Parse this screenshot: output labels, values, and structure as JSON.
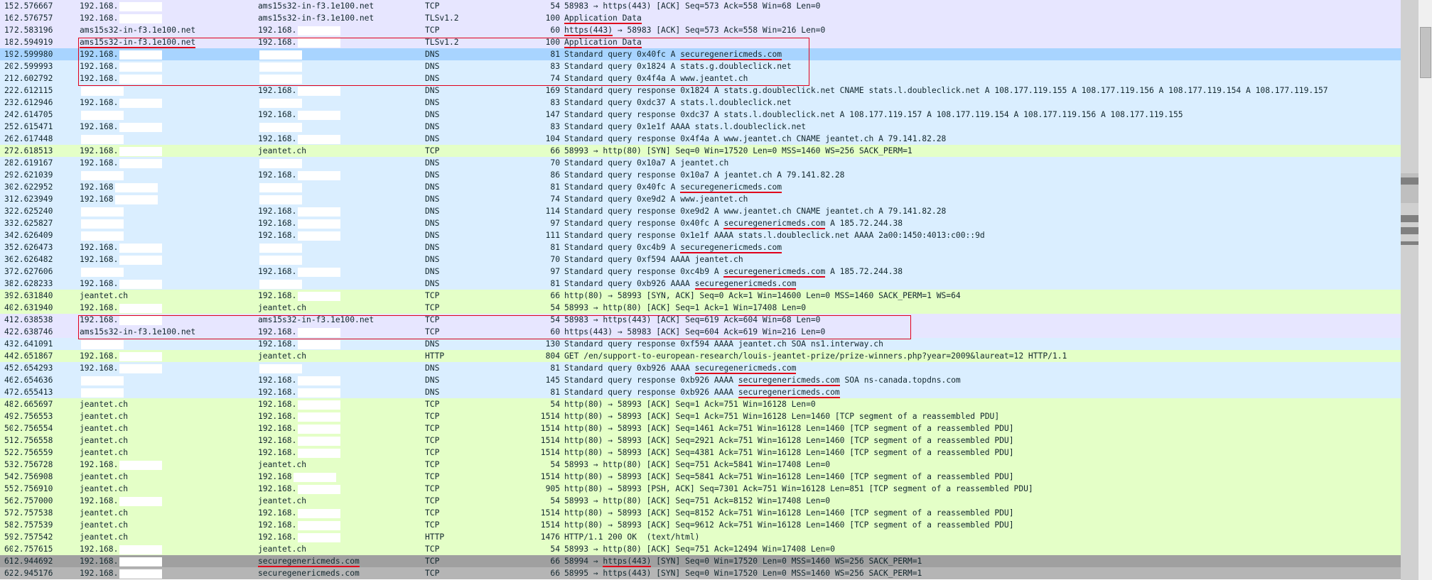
{
  "packets": [
    {
      "no": "15",
      "time": "2.576667",
      "src": "192.168.",
      "dst": "ams15s32-in-f3.1e100.net",
      "proto": "TCP",
      "len": "54",
      "info": "58983 → https(443) [ACK] Seq=573 Ack=558 Win=68 Len=0",
      "bg": "tcp"
    },
    {
      "no": "16",
      "time": "2.576757",
      "src": "192.168.",
      "dst": "ams15s32-in-f3.1e100.net",
      "proto": "TLSv1.2",
      "len": "100",
      "info": "Application Data",
      "bg": "tcp"
    },
    {
      "no": "17",
      "time": "2.583196",
      "src": "ams15s32-in-f3.1e100.net",
      "dst": "192.168.",
      "proto": "TCP",
      "len": "60",
      "info": "https(443) → 58983 [ACK] Seq=573 Ack=558 Win=216 Len=0",
      "bg": "tcp"
    },
    {
      "no": "18",
      "time": "2.594919",
      "src": "ams15s32-in-f3.1e100.net",
      "dst": "192.168.",
      "proto": "TLSv1.2",
      "len": "100",
      "info": "Application Data",
      "bg": "tcp"
    },
    {
      "no": "19",
      "time": "2.599980",
      "src": "192.168.",
      "dst": "",
      "proto": "DNS",
      "len": "81",
      "info": "Standard query 0x40fc A securegenericmeds.com",
      "bg": "sel"
    },
    {
      "no": "20",
      "time": "2.599993",
      "src": "192.168.",
      "dst": "",
      "proto": "DNS",
      "len": "83",
      "info": "Standard query 0x1824 A stats.g.doubleclick.net",
      "bg": "dns"
    },
    {
      "no": "21",
      "time": "2.602792",
      "src": "192.168.",
      "dst": "",
      "proto": "DNS",
      "len": "74",
      "info": "Standard query 0x4f4a A www.jeantet.ch",
      "bg": "dns"
    },
    {
      "no": "22",
      "time": "2.612115",
      "src": "",
      "dst": "192.168.",
      "proto": "DNS",
      "len": "169",
      "info": "Standard query response 0x1824 A stats.g.doubleclick.net CNAME stats.l.doubleclick.net A 108.177.119.155 A 108.177.119.156 A 108.177.119.154 A 108.177.119.157",
      "bg": "dns"
    },
    {
      "no": "23",
      "time": "2.612946",
      "src": "192.168.",
      "dst": "",
      "proto": "DNS",
      "len": "83",
      "info": "Standard query 0xdc37 A stats.l.doubleclick.net",
      "bg": "dns"
    },
    {
      "no": "24",
      "time": "2.614705",
      "src": "",
      "dst": "192.168.",
      "proto": "DNS",
      "len": "147",
      "info": "Standard query response 0xdc37 A stats.l.doubleclick.net A 108.177.119.157 A 108.177.119.154 A 108.177.119.156 A 108.177.119.155",
      "bg": "dns"
    },
    {
      "no": "25",
      "time": "2.615471",
      "src": "192.168.",
      "dst": "",
      "proto": "DNS",
      "len": "83",
      "info": "Standard query 0x1e1f AAAA stats.l.doubleclick.net",
      "bg": "dns"
    },
    {
      "no": "26",
      "time": "2.617448",
      "src": "",
      "dst": "192.168.",
      "proto": "DNS",
      "len": "104",
      "info": "Standard query response 0x4f4a A www.jeantet.ch CNAME jeantet.ch A 79.141.82.28",
      "bg": "dns"
    },
    {
      "no": "27",
      "time": "2.618513",
      "src": "192.168.",
      "dst": "jeantet.ch",
      "proto": "TCP",
      "len": "66",
      "info": "58993 → http(80) [SYN] Seq=0 Win=17520 Len=0 MSS=1460 WS=256 SACK_PERM=1",
      "bg": "http"
    },
    {
      "no": "28",
      "time": "2.619167",
      "src": "192.168.",
      "dst": "",
      "proto": "DNS",
      "len": "70",
      "info": "Standard query 0x10a7 A jeantet.ch",
      "bg": "dns"
    },
    {
      "no": "29",
      "time": "2.621039",
      "src": "",
      "dst": "192.168.",
      "proto": "DNS",
      "len": "86",
      "info": "Standard query response 0x10a7 A jeantet.ch A 79.141.82.28",
      "bg": "dns"
    },
    {
      "no": "30",
      "time": "2.622952",
      "src": "192.168",
      "dst": "",
      "proto": "DNS",
      "len": "81",
      "info": "Standard query 0x40fc A securegenericmeds.com",
      "bg": "dns"
    },
    {
      "no": "31",
      "time": "2.623949",
      "src": "192.168",
      "dst": "",
      "proto": "DNS",
      "len": "74",
      "info": "Standard query 0xe9d2 A www.jeantet.ch",
      "bg": "dns"
    },
    {
      "no": "32",
      "time": "2.625240",
      "src": "",
      "dst": "192.168.",
      "proto": "DNS",
      "len": "114",
      "info": "Standard query response 0xe9d2 A www.jeantet.ch CNAME jeantet.ch A 79.141.82.28",
      "bg": "dns"
    },
    {
      "no": "33",
      "time": "2.625827",
      "src": "",
      "dst": "192.168.",
      "proto": "DNS",
      "len": "97",
      "info": "Standard query response 0x40fc A securegenericmeds.com A 185.72.244.38",
      "bg": "dns"
    },
    {
      "no": "34",
      "time": "2.626409",
      "src": "",
      "dst": "192.168.",
      "proto": "DNS",
      "len": "111",
      "info": "Standard query response 0x1e1f AAAA stats.l.doubleclick.net AAAA 2a00:1450:4013:c00::9d",
      "bg": "dns"
    },
    {
      "no": "35",
      "time": "2.626473",
      "src": "192.168.",
      "dst": "",
      "proto": "DNS",
      "len": "81",
      "info": "Standard query 0xc4b9 A securegenericmeds.com",
      "bg": "dns"
    },
    {
      "no": "36",
      "time": "2.626482",
      "src": "192.168.",
      "dst": "",
      "proto": "DNS",
      "len": "70",
      "info": "Standard query 0xf594 AAAA jeantet.ch",
      "bg": "dns"
    },
    {
      "no": "37",
      "time": "2.627606",
      "src": "",
      "dst": "192.168.",
      "proto": "DNS",
      "len": "97",
      "info": "Standard query response 0xc4b9 A securegenericmeds.com A 185.72.244.38",
      "bg": "dns"
    },
    {
      "no": "38",
      "time": "2.628233",
      "src": "192.168.",
      "dst": "",
      "proto": "DNS",
      "len": "81",
      "info": "Standard query 0xb926 AAAA securegenericmeds.com",
      "bg": "dns"
    },
    {
      "no": "39",
      "time": "2.631840",
      "src": "jeantet.ch",
      "dst": "192.168.",
      "proto": "TCP",
      "len": "66",
      "info": "http(80) → 58993 [SYN, ACK] Seq=0 Ack=1 Win=14600 Len=0 MSS=1460 SACK_PERM=1 WS=64",
      "bg": "http"
    },
    {
      "no": "40",
      "time": "2.631940",
      "src": "192.168.",
      "dst": "jeantet.ch",
      "proto": "TCP",
      "len": "54",
      "info": "58993 → http(80) [ACK] Seq=1 Ack=1 Win=17408 Len=0",
      "bg": "http"
    },
    {
      "no": "41",
      "time": "2.638538",
      "src": "192.168.",
      "dst": "ams15s32-in-f3.1e100.net",
      "proto": "TCP",
      "len": "54",
      "info": "58983 → https(443) [ACK] Seq=619 Ack=604 Win=68 Len=0",
      "bg": "tcp"
    },
    {
      "no": "42",
      "time": "2.638746",
      "src": "ams15s32-in-f3.1e100.net",
      "dst": "192.168.",
      "proto": "TCP",
      "len": "60",
      "info": "https(443) → 58983 [ACK] Seq=604 Ack=619 Win=216 Len=0",
      "bg": "tcp"
    },
    {
      "no": "43",
      "time": "2.641091",
      "src": "",
      "dst": "192.168.",
      "proto": "DNS",
      "len": "130",
      "info": "Standard query response 0xf594 AAAA jeantet.ch SOA ns1.interway.ch",
      "bg": "dns"
    },
    {
      "no": "44",
      "time": "2.651867",
      "src": "192.168.",
      "dst": "jeantet.ch",
      "proto": "HTTP",
      "len": "804",
      "info": "GET /en/support-to-european-research/louis-jeantet-prize/prize-winners.php?year=2009&laureat=12 HTTP/1.1",
      "bg": "http"
    },
    {
      "no": "45",
      "time": "2.654293",
      "src": "192.168.",
      "dst": "",
      "proto": "DNS",
      "len": "81",
      "info": "Standard query 0xb926 AAAA securegenericmeds.com",
      "bg": "dns"
    },
    {
      "no": "46",
      "time": "2.654636",
      "src": "",
      "dst": "192.168.",
      "proto": "DNS",
      "len": "145",
      "info": "Standard query response 0xb926 AAAA securegenericmeds.com SOA ns-canada.topdns.com",
      "bg": "dns"
    },
    {
      "no": "47",
      "time": "2.655413",
      "src": "",
      "dst": "192.168.",
      "proto": "DNS",
      "len": "81",
      "info": "Standard query response 0xb926 AAAA securegenericmeds.com",
      "bg": "dns"
    },
    {
      "no": "48",
      "time": "2.665697",
      "src": "jeantet.ch",
      "dst": "192.168.",
      "proto": "TCP",
      "len": "54",
      "info": "http(80) → 58993 [ACK] Seq=1 Ack=751 Win=16128 Len=0",
      "bg": "http"
    },
    {
      "no": "49",
      "time": "2.756553",
      "src": "jeantet.ch",
      "dst": "192.168.",
      "proto": "TCP",
      "len": "1514",
      "info": "http(80) → 58993 [ACK] Seq=1 Ack=751 Win=16128 Len=1460 [TCP segment of a reassembled PDU]",
      "bg": "http"
    },
    {
      "no": "50",
      "time": "2.756554",
      "src": "jeantet.ch",
      "dst": "192.168.",
      "proto": "TCP",
      "len": "1514",
      "info": "http(80) → 58993 [ACK] Seq=1461 Ack=751 Win=16128 Len=1460 [TCP segment of a reassembled PDU]",
      "bg": "http"
    },
    {
      "no": "51",
      "time": "2.756558",
      "src": "jeantet.ch",
      "dst": "192.168.",
      "proto": "TCP",
      "len": "1514",
      "info": "http(80) → 58993 [ACK] Seq=2921 Ack=751 Win=16128 Len=1460 [TCP segment of a reassembled PDU]",
      "bg": "http"
    },
    {
      "no": "52",
      "time": "2.756559",
      "src": "jeantet.ch",
      "dst": "192.168.",
      "proto": "TCP",
      "len": "1514",
      "info": "http(80) → 58993 [ACK] Seq=4381 Ack=751 Win=16128 Len=1460 [TCP segment of a reassembled PDU]",
      "bg": "http"
    },
    {
      "no": "53",
      "time": "2.756728",
      "src": "192.168.",
      "dst": "jeantet.ch",
      "proto": "TCP",
      "len": "54",
      "info": "58993 → http(80) [ACK] Seq=751 Ack=5841 Win=17408 Len=0",
      "bg": "http"
    },
    {
      "no": "54",
      "time": "2.756908",
      "src": "jeantet.ch",
      "dst": "192.168",
      "proto": "TCP",
      "len": "1514",
      "info": "http(80) → 58993 [ACK] Seq=5841 Ack=751 Win=16128 Len=1460 [TCP segment of a reassembled PDU]",
      "bg": "http"
    },
    {
      "no": "55",
      "time": "2.756910",
      "src": "jeantet.ch",
      "dst": "192.168.",
      "proto": "TCP",
      "len": "905",
      "info": "http(80) → 58993 [PSH, ACK] Seq=7301 Ack=751 Win=16128 Len=851 [TCP segment of a reassembled PDU]",
      "bg": "http"
    },
    {
      "no": "56",
      "time": "2.757000",
      "src": "192.168.",
      "dst": "jeantet.ch",
      "proto": "TCP",
      "len": "54",
      "info": "58993 → http(80) [ACK] Seq=751 Ack=8152 Win=17408 Len=0",
      "bg": "http"
    },
    {
      "no": "57",
      "time": "2.757538",
      "src": "jeantet.ch",
      "dst": "192.168.",
      "proto": "TCP",
      "len": "1514",
      "info": "http(80) → 58993 [ACK] Seq=8152 Ack=751 Win=16128 Len=1460 [TCP segment of a reassembled PDU]",
      "bg": "http"
    },
    {
      "no": "58",
      "time": "2.757539",
      "src": "jeantet.ch",
      "dst": "192.168.",
      "proto": "TCP",
      "len": "1514",
      "info": "http(80) → 58993 [ACK] Seq=9612 Ack=751 Win=16128 Len=1460 [TCP segment of a reassembled PDU]",
      "bg": "http"
    },
    {
      "no": "59",
      "time": "2.757542",
      "src": "jeantet.ch",
      "dst": "192.168.",
      "proto": "HTTP",
      "len": "1476",
      "info": "HTTP/1.1 200 OK  (text/html)",
      "bg": "http"
    },
    {
      "no": "60",
      "time": "2.757615",
      "src": "192.168.",
      "dst": "jeantet.ch",
      "proto": "TCP",
      "len": "54",
      "info": "58993 → http(80) [ACK] Seq=751 Ack=12494 Win=17408 Len=0",
      "bg": "http"
    },
    {
      "no": "61",
      "time": "2.944692",
      "src": "192.168.",
      "dst": "securegenericmeds.com",
      "proto": "TCP",
      "len": "66",
      "info": "58994 → https(443) [SYN] Seq=0 Win=17520 Len=0 MSS=1460 WS=256 SACK_PERM=1",
      "bg": "gray"
    },
    {
      "no": "62",
      "time": "2.945176",
      "src": "192.168.",
      "dst": "securegenericmeds.com",
      "proto": "TCP",
      "len": "66",
      "info": "58995 → https(443) [SYN] Seq=0 Win=17520 Len=0 MSS=1460 WS=256 SACK_PERM=1",
      "bg": "grayl"
    }
  ],
  "colors": {
    "tcp": "#e7e6ff",
    "dns": "#daeeff",
    "http": "#e4ffc7",
    "selected": "#a8d4ff",
    "bad_tcp": "#a0a0a0",
    "annotation_red": "#e0001b"
  }
}
